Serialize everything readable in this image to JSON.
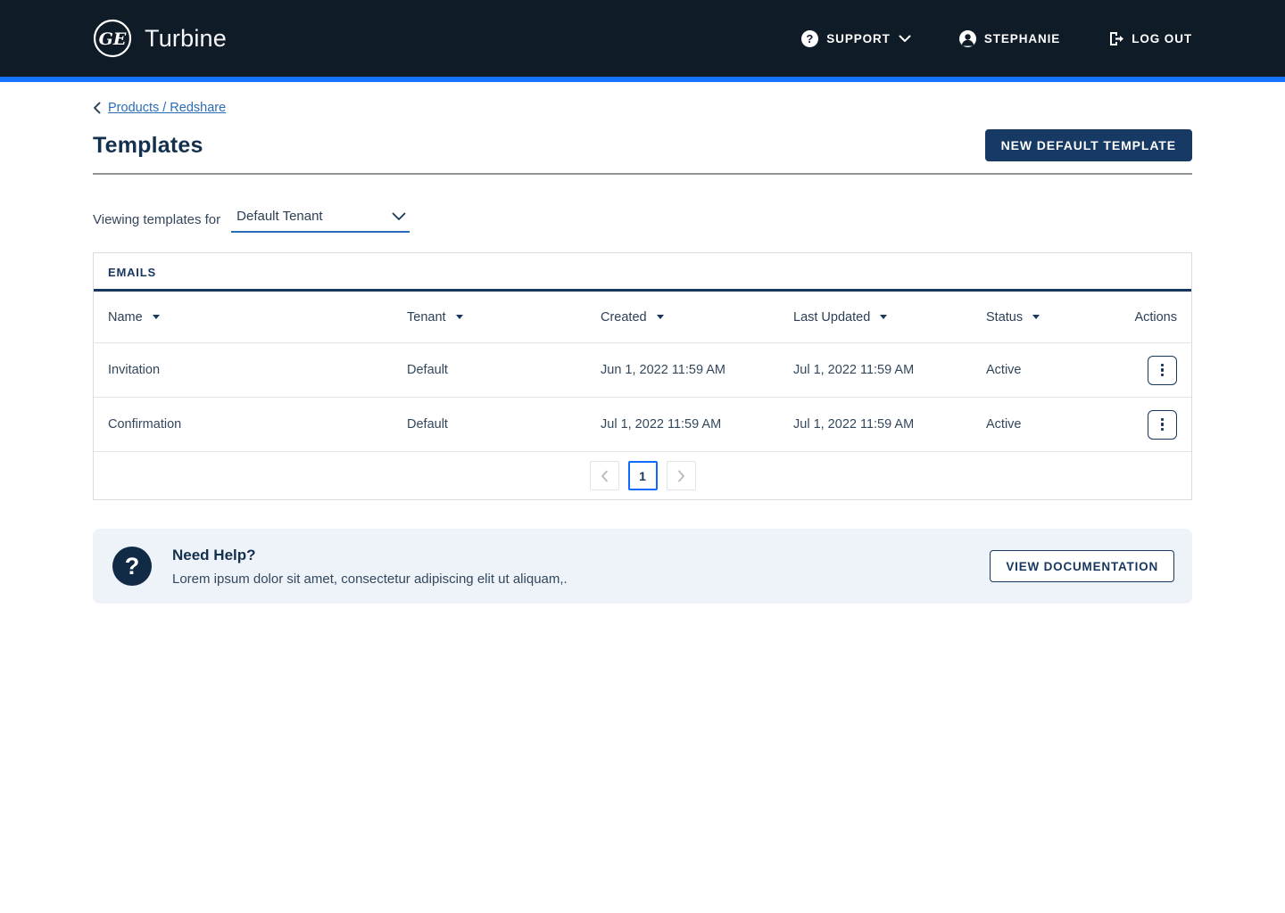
{
  "header": {
    "brand": "Turbine",
    "support_label": "SUPPORT",
    "user_label": "STEPHANIE",
    "logout_label": "LOG OUT",
    "question_glyph": "?"
  },
  "breadcrumb": {
    "label": "Products / Redshare"
  },
  "page": {
    "title": "Templates",
    "new_template_button": "NEW DEFAULT TEMPLATE",
    "viewing_label": "Viewing templates for",
    "tenant_select_value": "Default Tenant"
  },
  "table": {
    "tab_label": "EMAILS",
    "columns": [
      {
        "label": "Name"
      },
      {
        "label": "Tenant"
      },
      {
        "label": "Created"
      },
      {
        "label": "Last Updated"
      },
      {
        "label": "Status"
      },
      {
        "label": "Actions"
      }
    ],
    "rows": [
      {
        "name": "Invitation",
        "tenant": "Default",
        "created": "Jun 1, 2022 11:59 AM",
        "last_updated": "Jul 1, 2022 11:59 AM",
        "status": "Active"
      },
      {
        "name": "Confirmation",
        "tenant": "Default",
        "created": "Jul 1, 2022 11:59 AM",
        "last_updated": "Jul 1, 2022 11:59 AM",
        "status": "Active"
      }
    ],
    "pagination": {
      "current_page": "1"
    }
  },
  "help": {
    "title": "Need Help?",
    "body": "Lorem ipsum dolor sit amet, consectetur adipiscing elit ut aliquam,.",
    "button": "VIEW DOCUMENTATION",
    "question_glyph": "?"
  },
  "colors": {
    "header_bg": "#101b28",
    "accent_bar": "#1673ff",
    "navy": "#17375e",
    "link_blue": "#2b6cb8",
    "button_navy": "#173a64",
    "help_bg": "#eef3fa",
    "active_page_border": "#0f6bff"
  }
}
